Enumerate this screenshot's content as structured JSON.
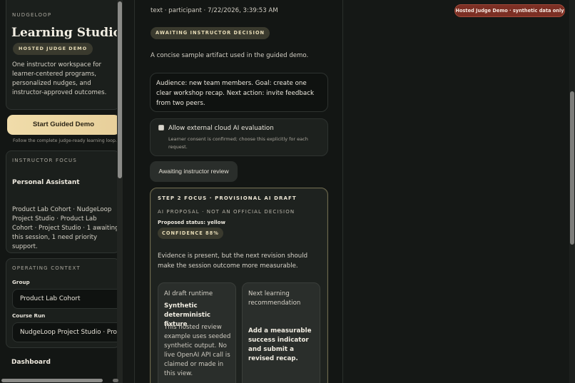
{
  "sidebar": {
    "brand": {
      "eyebrow": "NUDGELOOP",
      "title": "Learning Studio",
      "badge": "HOSTED JUDGE DEMO",
      "description": "One instructor workspace for learner-centered programs, personalized nudges, and instructor-approved outcomes."
    },
    "cta": {
      "label": "Start Guided Demo",
      "subtext": "Follow the complete judge-ready learning loop."
    },
    "focus": {
      "eyebrow": "INSTRUCTOR FOCUS",
      "title": "Personal Assistant",
      "description": "Product Lab Cohort · NudgeLoop Project Studio · Product Lab Cohort · Project Studio · 1 awaiting this session, 1 need priority support."
    },
    "context": {
      "eyebrow": "OPERATING CONTEXT",
      "group_label": "Group",
      "group_value": "Product Lab Cohort",
      "course_label": "Course Run",
      "course_value": "NudgeLoop Project Studio · Product Lab Cohort"
    },
    "dashboard_label": "Dashboard"
  },
  "main": {
    "meta": "text · participant · 7/22/2026, 3:39:53 AM",
    "status_badge": "AWAITING INSTRUCTOR DECISION",
    "artifact_description": "A concise sample artifact used in the guided demo.",
    "artifact_content": "Audience: new team members. Goal: create one clear workshop recap. Next action: invite feedback from two peers.",
    "consent": {
      "label": "Allow external cloud AI evaluation",
      "help": "Learner consent is confirmed; choose this explicitly for each request.",
      "checked": false
    },
    "review_button": "Awaiting instructor review",
    "draft": {
      "eyebrow": "STEP 2 FOCUS · PROVISIONAL AI DRAFT",
      "proposal": "AI PROPOSAL · NOT AN OFFICIAL DECISION",
      "proposed_status": "Proposed status: yellow",
      "confidence": "CONFIDENCE 88%",
      "evidence": "Evidence is present, but the next revision should make the session outcome more measurable.",
      "runtime": {
        "title": "AI draft runtime",
        "strong": "Synthetic deterministic fixture",
        "body": "This hosted review example uses seeded synthetic output. No live OpenAI API call is claimed or made in this view."
      },
      "recommendation": {
        "title": "Next learning recommendation",
        "strong": "Add a measurable success indicator and submit a revised recap."
      }
    }
  },
  "demo_badge": "Hosted Judge Demo · synthetic data only",
  "colors": {
    "background": "#151816",
    "cta": "#f0dcaa",
    "badge_red": "#7c2f24",
    "pill": "#3a3a2e",
    "draft_border": "#6e6a4f"
  }
}
